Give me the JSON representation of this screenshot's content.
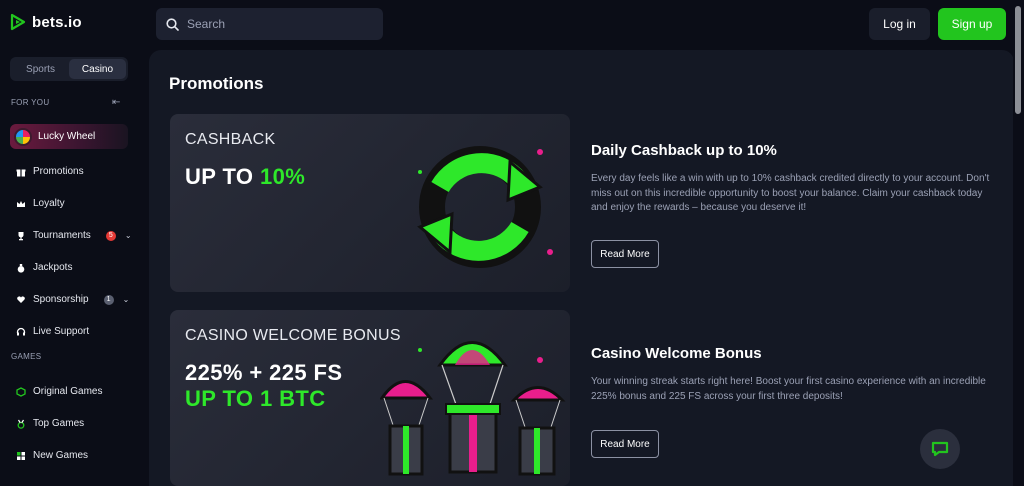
{
  "brand": {
    "name": "bets.io",
    "accent": "#22c51e"
  },
  "search": {
    "placeholder": "Search"
  },
  "auth": {
    "login_label": "Log in",
    "signup_label": "Sign up"
  },
  "sidebar": {
    "toggle": [
      "Sports",
      "Casino"
    ],
    "active_toggle": "Casino",
    "for_you_label": "FOR YOU",
    "lucky_wheel": "Lucky Wheel",
    "items": [
      {
        "label": "Promotions",
        "icon": "gift-icon"
      },
      {
        "label": "Loyalty",
        "icon": "crown-icon"
      },
      {
        "label": "Tournaments",
        "icon": "trophy-icon",
        "badge": "5",
        "badge_color": "#e53935"
      },
      {
        "label": "Jackpots",
        "icon": "money-bag-icon"
      },
      {
        "label": "Sponsorship",
        "icon": "heart-hand-icon",
        "badge": "1",
        "badge_color": "#5a5f70"
      },
      {
        "label": "Live Support",
        "icon": "headset-icon"
      }
    ],
    "games_label": "GAMES",
    "games": [
      {
        "label": "Original Games",
        "icon": "cube-icon"
      },
      {
        "label": "Top Games",
        "icon": "medal-icon"
      },
      {
        "label": "New Games",
        "icon": "grid-icon"
      }
    ]
  },
  "main": {
    "title": "Promotions",
    "promos": [
      {
        "card_small": "CASHBACK",
        "card_big_prefix": "UP TO ",
        "card_big_highlight": "10%",
        "title": "Daily Cashback up to 10%",
        "description": "Every day feels like a win with up to 10% cashback credited directly to your account. Don't miss out on this incredible opportunity to boost your balance. Claim your cashback today and enjoy the rewards – because you deserve it!",
        "button": "Read More"
      },
      {
        "card_small": "CASINO WELCOME BONUS",
        "card_big_line1": "225% + 225 FS",
        "card_big_line2": "UP TO 1 BTC",
        "title": "Casino Welcome Bonus",
        "description": "Your winning streak starts right here! Boost your first casino experience with an incredible 225% bonus and 225 FS across your first three deposits!",
        "button": "Read More"
      }
    ]
  }
}
